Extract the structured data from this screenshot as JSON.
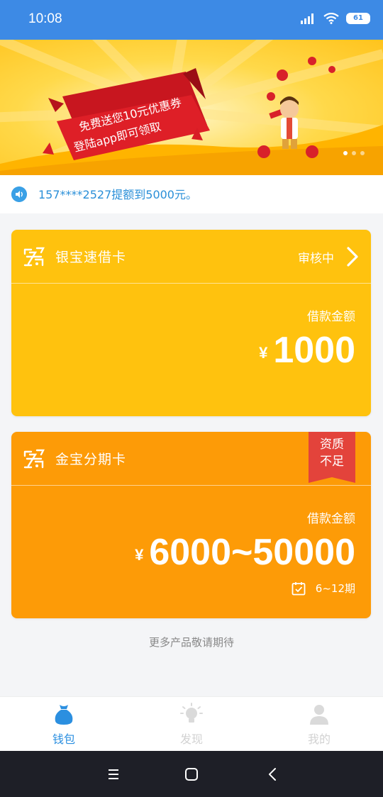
{
  "status_bar": {
    "time": "10:08",
    "battery": "61"
  },
  "banner": {
    "line1": "免费送您10元优惠券",
    "line2": "登陆app即可领取",
    "dots": 3,
    "active_dot": 0
  },
  "notice": {
    "text": "157****2527提额到5000元。"
  },
  "cards": [
    {
      "title": "银宝速借卡",
      "status": "审核中",
      "amount_label": "借款金额",
      "currency": "¥",
      "amount": "1000"
    },
    {
      "title": "金宝分期卡",
      "badge_line1": "资质",
      "badge_line2": "不足",
      "amount_label": "借款金额",
      "currency": "¥",
      "amount": "6000~50000",
      "period": "6~12期"
    }
  ],
  "more_text": "更多产品敬请期待",
  "tabs": [
    {
      "label": "钱包",
      "active": true
    },
    {
      "label": "发现",
      "active": false
    },
    {
      "label": "我的",
      "active": false
    }
  ],
  "colors": {
    "status_bar": "#3d8ae5",
    "card1": "#ffc20e",
    "card2": "#fd9b07",
    "badge": "#e3433b",
    "accent": "#2b8fe0"
  }
}
